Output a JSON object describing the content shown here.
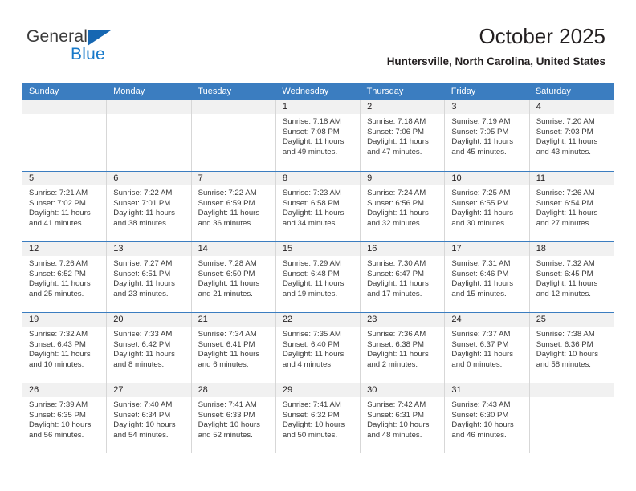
{
  "brand": {
    "name_primary": "General",
    "name_secondary": "Blue",
    "triangle_color": "#1667b2",
    "blue_text_color": "#1779c9"
  },
  "header": {
    "month_title": "October 2025",
    "location": "Huntersville, North Carolina, United States"
  },
  "theme": {
    "header_blue": "#3b7dc0",
    "daynum_gray": "#f1f1f1",
    "grid_border": "#d7d7d7",
    "text_color": "#231f20"
  },
  "calendar": {
    "weekday_headers": [
      "Sunday",
      "Monday",
      "Tuesday",
      "Wednesday",
      "Thursday",
      "Friday",
      "Saturday"
    ],
    "weeks": [
      [
        {
          "empty": true
        },
        {
          "empty": true
        },
        {
          "empty": true
        },
        {
          "day": "1",
          "sunrise": "Sunrise: 7:18 AM",
          "sunset": "Sunset: 7:08 PM",
          "daylight": "Daylight: 11 hours and 49 minutes."
        },
        {
          "day": "2",
          "sunrise": "Sunrise: 7:18 AM",
          "sunset": "Sunset: 7:06 PM",
          "daylight": "Daylight: 11 hours and 47 minutes."
        },
        {
          "day": "3",
          "sunrise": "Sunrise: 7:19 AM",
          "sunset": "Sunset: 7:05 PM",
          "daylight": "Daylight: 11 hours and 45 minutes."
        },
        {
          "day": "4",
          "sunrise": "Sunrise: 7:20 AM",
          "sunset": "Sunset: 7:03 PM",
          "daylight": "Daylight: 11 hours and 43 minutes."
        }
      ],
      [
        {
          "day": "5",
          "sunrise": "Sunrise: 7:21 AM",
          "sunset": "Sunset: 7:02 PM",
          "daylight": "Daylight: 11 hours and 41 minutes."
        },
        {
          "day": "6",
          "sunrise": "Sunrise: 7:22 AM",
          "sunset": "Sunset: 7:01 PM",
          "daylight": "Daylight: 11 hours and 38 minutes."
        },
        {
          "day": "7",
          "sunrise": "Sunrise: 7:22 AM",
          "sunset": "Sunset: 6:59 PM",
          "daylight": "Daylight: 11 hours and 36 minutes."
        },
        {
          "day": "8",
          "sunrise": "Sunrise: 7:23 AM",
          "sunset": "Sunset: 6:58 PM",
          "daylight": "Daylight: 11 hours and 34 minutes."
        },
        {
          "day": "9",
          "sunrise": "Sunrise: 7:24 AM",
          "sunset": "Sunset: 6:56 PM",
          "daylight": "Daylight: 11 hours and 32 minutes."
        },
        {
          "day": "10",
          "sunrise": "Sunrise: 7:25 AM",
          "sunset": "Sunset: 6:55 PM",
          "daylight": "Daylight: 11 hours and 30 minutes."
        },
        {
          "day": "11",
          "sunrise": "Sunrise: 7:26 AM",
          "sunset": "Sunset: 6:54 PM",
          "daylight": "Daylight: 11 hours and 27 minutes."
        }
      ],
      [
        {
          "day": "12",
          "sunrise": "Sunrise: 7:26 AM",
          "sunset": "Sunset: 6:52 PM",
          "daylight": "Daylight: 11 hours and 25 minutes."
        },
        {
          "day": "13",
          "sunrise": "Sunrise: 7:27 AM",
          "sunset": "Sunset: 6:51 PM",
          "daylight": "Daylight: 11 hours and 23 minutes."
        },
        {
          "day": "14",
          "sunrise": "Sunrise: 7:28 AM",
          "sunset": "Sunset: 6:50 PM",
          "daylight": "Daylight: 11 hours and 21 minutes."
        },
        {
          "day": "15",
          "sunrise": "Sunrise: 7:29 AM",
          "sunset": "Sunset: 6:48 PM",
          "daylight": "Daylight: 11 hours and 19 minutes."
        },
        {
          "day": "16",
          "sunrise": "Sunrise: 7:30 AM",
          "sunset": "Sunset: 6:47 PM",
          "daylight": "Daylight: 11 hours and 17 minutes."
        },
        {
          "day": "17",
          "sunrise": "Sunrise: 7:31 AM",
          "sunset": "Sunset: 6:46 PM",
          "daylight": "Daylight: 11 hours and 15 minutes."
        },
        {
          "day": "18",
          "sunrise": "Sunrise: 7:32 AM",
          "sunset": "Sunset: 6:45 PM",
          "daylight": "Daylight: 11 hours and 12 minutes."
        }
      ],
      [
        {
          "day": "19",
          "sunrise": "Sunrise: 7:32 AM",
          "sunset": "Sunset: 6:43 PM",
          "daylight": "Daylight: 11 hours and 10 minutes."
        },
        {
          "day": "20",
          "sunrise": "Sunrise: 7:33 AM",
          "sunset": "Sunset: 6:42 PM",
          "daylight": "Daylight: 11 hours and 8 minutes."
        },
        {
          "day": "21",
          "sunrise": "Sunrise: 7:34 AM",
          "sunset": "Sunset: 6:41 PM",
          "daylight": "Daylight: 11 hours and 6 minutes."
        },
        {
          "day": "22",
          "sunrise": "Sunrise: 7:35 AM",
          "sunset": "Sunset: 6:40 PM",
          "daylight": "Daylight: 11 hours and 4 minutes."
        },
        {
          "day": "23",
          "sunrise": "Sunrise: 7:36 AM",
          "sunset": "Sunset: 6:38 PM",
          "daylight": "Daylight: 11 hours and 2 minutes."
        },
        {
          "day": "24",
          "sunrise": "Sunrise: 7:37 AM",
          "sunset": "Sunset: 6:37 PM",
          "daylight": "Daylight: 11 hours and 0 minutes."
        },
        {
          "day": "25",
          "sunrise": "Sunrise: 7:38 AM",
          "sunset": "Sunset: 6:36 PM",
          "daylight": "Daylight: 10 hours and 58 minutes."
        }
      ],
      [
        {
          "day": "26",
          "sunrise": "Sunrise: 7:39 AM",
          "sunset": "Sunset: 6:35 PM",
          "daylight": "Daylight: 10 hours and 56 minutes."
        },
        {
          "day": "27",
          "sunrise": "Sunrise: 7:40 AM",
          "sunset": "Sunset: 6:34 PM",
          "daylight": "Daylight: 10 hours and 54 minutes."
        },
        {
          "day": "28",
          "sunrise": "Sunrise: 7:41 AM",
          "sunset": "Sunset: 6:33 PM",
          "daylight": "Daylight: 10 hours and 52 minutes."
        },
        {
          "day": "29",
          "sunrise": "Sunrise: 7:41 AM",
          "sunset": "Sunset: 6:32 PM",
          "daylight": "Daylight: 10 hours and 50 minutes."
        },
        {
          "day": "30",
          "sunrise": "Sunrise: 7:42 AM",
          "sunset": "Sunset: 6:31 PM",
          "daylight": "Daylight: 10 hours and 48 minutes."
        },
        {
          "day": "31",
          "sunrise": "Sunrise: 7:43 AM",
          "sunset": "Sunset: 6:30 PM",
          "daylight": "Daylight: 10 hours and 46 minutes."
        },
        {
          "empty": true
        }
      ]
    ]
  }
}
